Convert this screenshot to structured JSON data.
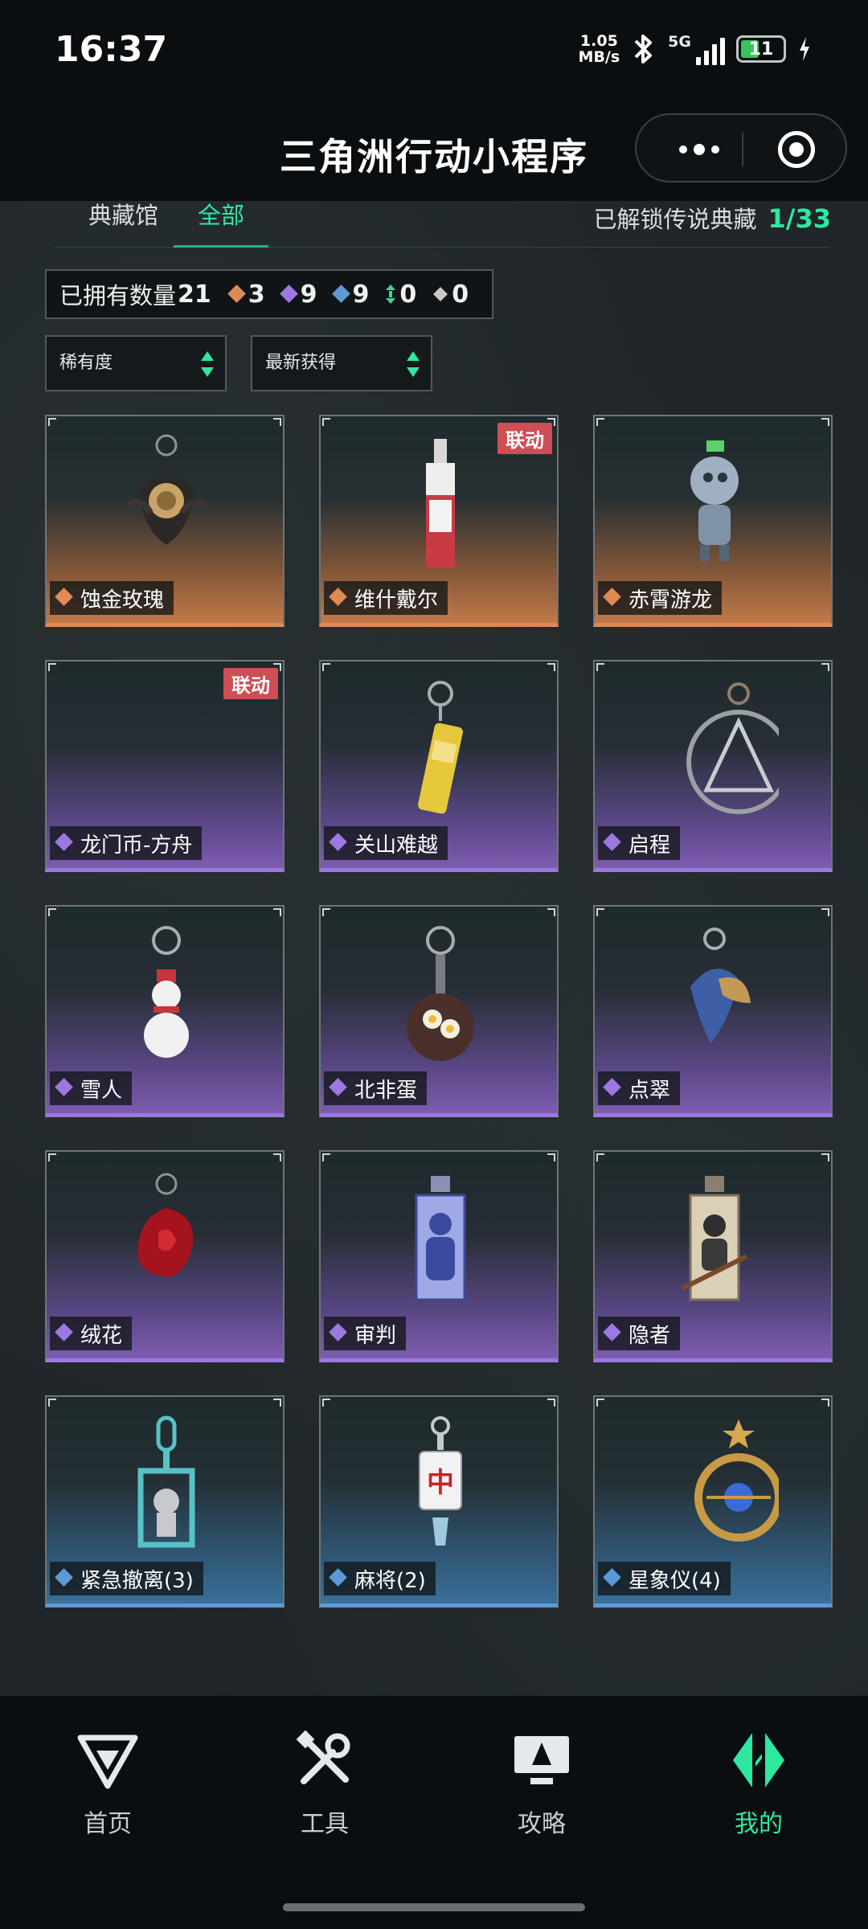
{
  "status_bar": {
    "time": "16:37",
    "net_speed_value": "1.05",
    "net_speed_unit": "MB/s",
    "network": "5G",
    "battery": "11"
  },
  "title_bar": {
    "title": "三角洲行动小程序"
  },
  "tabs": {
    "items": [
      "典藏馆",
      "全部"
    ],
    "active_index": 1,
    "unlock_label": "已解锁传说典藏",
    "unlock_value": "1/33"
  },
  "owned": {
    "label": "已拥有数量",
    "count": "21",
    "stats": [
      {
        "value": "3",
        "color": "#e08a55"
      },
      {
        "value": "9",
        "color": "#9c78e0"
      },
      {
        "value": "9",
        "color": "#5c9ad6"
      },
      {
        "value": "0",
        "color": "#3fd49a"
      },
      {
        "value": "0",
        "color": "#c8c8c8"
      }
    ]
  },
  "filters": {
    "rarity": "稀有度",
    "sort": "最新获得"
  },
  "items": [
    {
      "name": "蚀金玫瑰",
      "rarity": "orange",
      "tag": ""
    },
    {
      "name": "维什戴尔",
      "rarity": "orange",
      "tag": "联动"
    },
    {
      "name": "赤霄游龙",
      "rarity": "orange",
      "tag": ""
    },
    {
      "name": "龙门币-方舟",
      "rarity": "purple",
      "tag": "联动"
    },
    {
      "name": "关山难越",
      "rarity": "purple",
      "tag": ""
    },
    {
      "name": "启程",
      "rarity": "purple",
      "tag": ""
    },
    {
      "name": "雪人",
      "rarity": "purple",
      "tag": ""
    },
    {
      "name": "北非蛋",
      "rarity": "purple",
      "tag": ""
    },
    {
      "name": "点翠",
      "rarity": "purple",
      "tag": ""
    },
    {
      "name": "绒花",
      "rarity": "purple",
      "tag": ""
    },
    {
      "name": "审判",
      "rarity": "purple",
      "tag": ""
    },
    {
      "name": "隐者",
      "rarity": "purple",
      "tag": ""
    },
    {
      "name": "紧急撤离(3)",
      "rarity": "blue",
      "tag": ""
    },
    {
      "name": "麻将(2)",
      "rarity": "blue",
      "tag": ""
    },
    {
      "name": "星象仪(4)",
      "rarity": "blue",
      "tag": ""
    }
  ],
  "rarity_colors": {
    "orange": "#e08a55",
    "purple": "#9c78e0",
    "blue": "#5c9ad6"
  },
  "bottom_nav": [
    {
      "label": "首页",
      "icon": "home-logo-icon",
      "active": false
    },
    {
      "label": "工具",
      "icon": "tools-icon",
      "active": false
    },
    {
      "label": "攻略",
      "icon": "guide-icon",
      "active": false
    },
    {
      "label": "我的",
      "icon": "profile-logo-icon",
      "active": true
    }
  ],
  "accent_color": "#2ee8a0"
}
